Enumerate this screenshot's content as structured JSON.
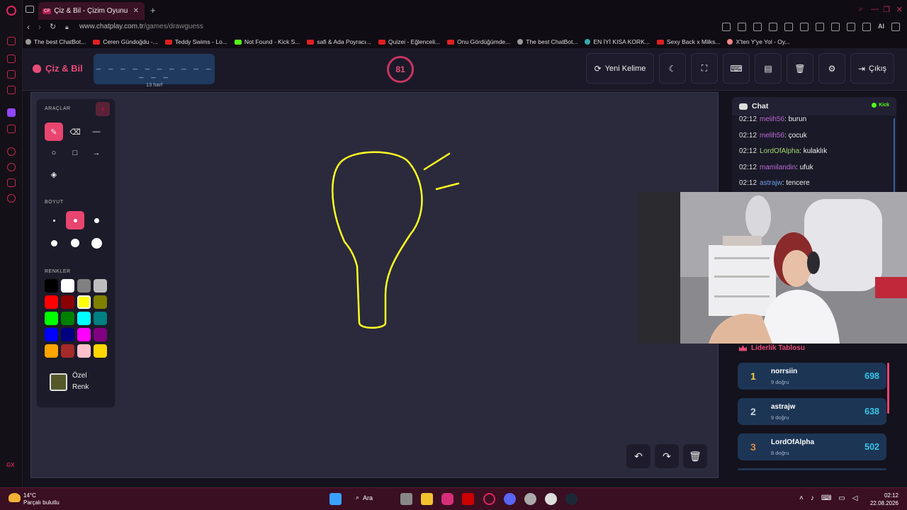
{
  "browser": {
    "tab_title": "Çiz & Bil - Çizim Oyunu",
    "tab_favicon": "CP",
    "url_host": "www.chatplay.com.tr",
    "url_path": "/games/drawguess",
    "ai_label": "AI",
    "bookmarks": [
      "The best ChatBot...",
      "Ceren Gündoğdu -...",
      "Teddy Swims - Lo...",
      "Not Found - Kick S...",
      "safi & Ada Poyracı...",
      "Quizei - Eğlenceli...",
      "Onu Gördüğümde...",
      "The best ChatBot...",
      "EN İYİ KISA KORK...",
      "Sexy Back x Milks...",
      "X'ten Y'ye Yol - Oy..."
    ],
    "rail_gx": "GX"
  },
  "header": {
    "brand": "Çiz & Bil",
    "word_mask": "_ _ _ _ _ _ _ _ _ _ _ _ _",
    "word_length": "13 harf",
    "timer": "81",
    "new_word": "Yeni Kelime",
    "exit": "Çıkış"
  },
  "tools": {
    "section_tools": "ARAÇLAR",
    "section_size": "BOYUT",
    "section_colors": "RENKLER",
    "custom_color_line1": "Özel",
    "custom_color_line2": "Renk",
    "colors": [
      "#000000",
      "#ffffff",
      "#808080",
      "#bdbdbd",
      "#ff0000",
      "#8b0000",
      "#ffff00",
      "#808000",
      "#00ff00",
      "#008000",
      "#00ffff",
      "#008080",
      "#0000ff",
      "#000080",
      "#ff00ff",
      "#800080",
      "#ffa500",
      "#a52a2a",
      "#ffc0cb",
      "#ffd700"
    ],
    "selected_color": "#ffff00",
    "custom_color": "#55592a"
  },
  "chat": {
    "title": "Chat",
    "platform": "Kick",
    "messages": [
      {
        "time": "02:12",
        "user": "melih56",
        "text": ": burun",
        "color": "#c06bd8"
      },
      {
        "time": "02:12",
        "user": "melih56",
        "text": ": çocuk",
        "color": "#c06bd8"
      },
      {
        "time": "02:12",
        "user": "LordOfAlpha",
        "text": ": kulaklık",
        "color": "#9fd96b"
      },
      {
        "time": "02:12",
        "user": "mamilandin",
        "text": ": ufuk",
        "color": "#c06bd8"
      },
      {
        "time": "02:12",
        "user": "astrajw",
        "text": ": tencere",
        "color": "#6b9fe8"
      }
    ]
  },
  "leaderboard": {
    "title": "Liderlik Tablosu",
    "rows": [
      {
        "rank": "1",
        "name": "norrsiin",
        "sub": "9 doğru",
        "score": "698",
        "rank_color": "#f2d13c"
      },
      {
        "rank": "2",
        "name": "astrajw",
        "sub": "9 doğru",
        "score": "638",
        "rank_color": "#c9d3dd"
      },
      {
        "rank": "3",
        "name": "LordOfAlpha",
        "sub": "8 doğru",
        "score": "502",
        "rank_color": "#e08a3a"
      }
    ]
  },
  "taskbar": {
    "temp": "14°C",
    "weather": "Parçalı bulutlu",
    "search": "Ara",
    "time": "02:12",
    "date": "22.08.2026"
  }
}
